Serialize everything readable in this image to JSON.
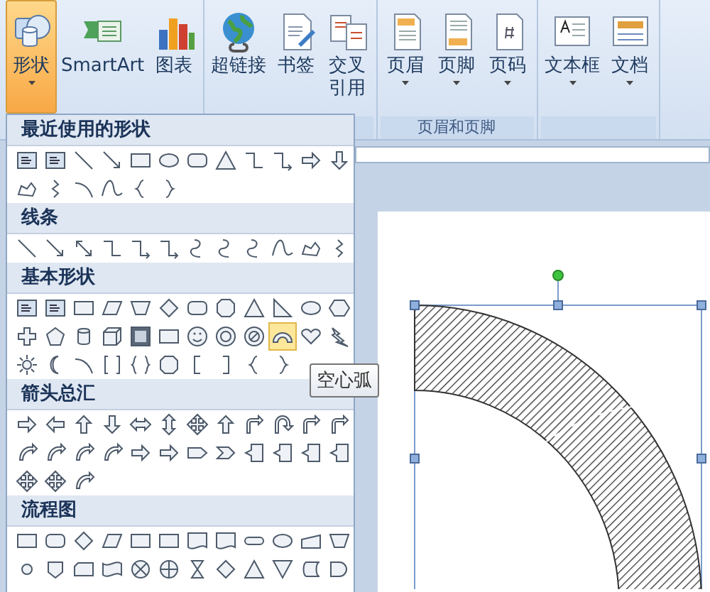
{
  "ribbon": {
    "groups": [
      {
        "buttons": [
          {
            "label": "形状",
            "has_menu": true,
            "selected": true
          },
          {
            "label": "SmartArt",
            "has_menu": false,
            "selected": false
          },
          {
            "label": "图表",
            "has_menu": false,
            "selected": false
          }
        ]
      },
      {
        "buttons": [
          {
            "label": "超链接",
            "has_menu": false,
            "selected": false
          },
          {
            "label": "书签",
            "has_menu": false,
            "selected": false
          },
          {
            "label": "交叉引用",
            "has_menu": false,
            "selected": false
          }
        ]
      },
      {
        "label": "页眉和页脚",
        "buttons": [
          {
            "label": "页眉",
            "has_menu": true,
            "selected": false
          },
          {
            "label": "页脚",
            "has_menu": true,
            "selected": false
          },
          {
            "label": "页码",
            "has_menu": true,
            "selected": false
          }
        ]
      },
      {
        "buttons": [
          {
            "label": "文本框",
            "has_menu": true,
            "selected": false
          },
          {
            "label": "文档",
            "has_menu": true,
            "selected": false
          }
        ]
      }
    ]
  },
  "shapes_menu": {
    "tooltip": "空心弧",
    "sections": [
      {
        "title": "最近使用的形状",
        "rows": [
          [
            {
              "kind": "textbox",
              "selected": false
            },
            {
              "kind": "textbox",
              "selected": false
            },
            {
              "kind": "line",
              "selected": false
            },
            {
              "kind": "arrowline",
              "selected": false
            },
            {
              "kind": "rect",
              "selected": false
            },
            {
              "kind": "oval",
              "selected": false
            },
            {
              "kind": "roundrect",
              "selected": false
            },
            {
              "kind": "triangle",
              "selected": false
            },
            {
              "kind": "elbow",
              "selected": false
            },
            {
              "kind": "elbowarrow",
              "selected": false
            },
            {
              "kind": "rarrow",
              "selected": false
            },
            {
              "kind": "darrow",
              "selected": false
            }
          ],
          [
            {
              "kind": "freeform",
              "selected": false
            },
            {
              "kind": "scribble",
              "selected": false
            },
            {
              "kind": "arc",
              "selected": false
            },
            {
              "kind": "curve",
              "selected": false
            },
            {
              "kind": "lbrace",
              "selected": false
            },
            {
              "kind": "rbrace",
              "selected": false
            }
          ]
        ]
      },
      {
        "title": "线条",
        "rows": [
          [
            {
              "kind": "line",
              "selected": false
            },
            {
              "kind": "arrowline",
              "selected": false
            },
            {
              "kind": "dblarrow",
              "selected": false
            },
            {
              "kind": "elbow",
              "selected": false
            },
            {
              "kind": "elbowarrow",
              "selected": false
            },
            {
              "kind": "elbowarrow",
              "selected": false
            },
            {
              "kind": "scurve",
              "selected": false
            },
            {
              "kind": "scurve",
              "selected": false
            },
            {
              "kind": "scurve",
              "selected": false
            },
            {
              "kind": "curve",
              "selected": false
            },
            {
              "kind": "freeform",
              "selected": false
            },
            {
              "kind": "scribble",
              "selected": false
            }
          ]
        ]
      },
      {
        "title": "基本形状",
        "rows": [
          [
            {
              "kind": "textbox",
              "selected": false
            },
            {
              "kind": "textbox",
              "selected": false
            },
            {
              "kind": "rect",
              "selected": false
            },
            {
              "kind": "parallelogram",
              "selected": false
            },
            {
              "kind": "trapezoid",
              "selected": false
            },
            {
              "kind": "diamond",
              "selected": false
            },
            {
              "kind": "roundrect",
              "selected": false
            },
            {
              "kind": "octagon",
              "selected": false
            },
            {
              "kind": "triangle",
              "selected": false
            },
            {
              "kind": "rtriangle",
              "selected": false
            },
            {
              "kind": "oval",
              "selected": false
            },
            {
              "kind": "hexagon",
              "selected": false
            }
          ],
          [
            {
              "kind": "plus",
              "selected": false
            },
            {
              "kind": "pentagon",
              "selected": false
            },
            {
              "kind": "can",
              "selected": false
            },
            {
              "kind": "cube",
              "selected": false
            },
            {
              "kind": "bevel",
              "selected": false
            },
            {
              "kind": "rect",
              "selected": false
            },
            {
              "kind": "smiley",
              "selected": false
            },
            {
              "kind": "donut",
              "selected": false
            },
            {
              "kind": "noentry",
              "selected": false
            },
            {
              "kind": "blockarc",
              "selected": true
            },
            {
              "kind": "heart",
              "selected": false
            },
            {
              "kind": "lightning",
              "selected": false
            }
          ],
          [
            {
              "kind": "sun",
              "selected": false
            },
            {
              "kind": "moon",
              "selected": false
            },
            {
              "kind": "arc",
              "selected": false
            },
            {
              "kind": "dblbracket",
              "selected": false
            },
            {
              "kind": "dblbrace",
              "selected": false
            },
            {
              "kind": "octagon",
              "selected": false
            },
            {
              "kind": "lbracket",
              "selected": false
            },
            {
              "kind": "rbracket",
              "selected": false
            },
            {
              "kind": "lbrace",
              "selected": false
            },
            {
              "kind": "rbrace",
              "selected": false
            }
          ]
        ]
      },
      {
        "title": "箭头总汇",
        "rows": [
          [
            {
              "kind": "rarrow",
              "selected": false
            },
            {
              "kind": "larrow",
              "selected": false
            },
            {
              "kind": "uarrow",
              "selected": false
            },
            {
              "kind": "darrow",
              "selected": false
            },
            {
              "kind": "lrarrow",
              "selected": false
            },
            {
              "kind": "udarrow",
              "selected": false
            },
            {
              "kind": "quadarrow",
              "selected": false
            },
            {
              "kind": "uarrow",
              "selected": false
            },
            {
              "kind": "bentarrow",
              "selected": false
            },
            {
              "kind": "uturn",
              "selected": false
            },
            {
              "kind": "bentarrow",
              "selected": false
            },
            {
              "kind": "bentarrow",
              "selected": false
            }
          ],
          [
            {
              "kind": "curvedarrow",
              "selected": false
            },
            {
              "kind": "curvedarrow",
              "selected": false
            },
            {
              "kind": "curvedarrow",
              "selected": false
            },
            {
              "kind": "curvedarrow",
              "selected": false
            },
            {
              "kind": "rarrow",
              "selected": false
            },
            {
              "kind": "rarrow",
              "selected": false
            },
            {
              "kind": "homeplate",
              "selected": false
            },
            {
              "kind": "chevron",
              "selected": false
            },
            {
              "kind": "callout",
              "selected": false
            },
            {
              "kind": "callout",
              "selected": false
            },
            {
              "kind": "callout",
              "selected": false
            },
            {
              "kind": "callout",
              "selected": false
            }
          ],
          [
            {
              "kind": "quadarrow",
              "selected": false
            },
            {
              "kind": "quadarrow",
              "selected": false
            },
            {
              "kind": "curvedarrow",
              "selected": false
            }
          ]
        ]
      },
      {
        "title": "流程图",
        "rows": [
          [
            {
              "kind": "rect",
              "selected": false
            },
            {
              "kind": "roundrect",
              "selected": false
            },
            {
              "kind": "diamond",
              "selected": false
            },
            {
              "kind": "parallelogram",
              "selected": false
            },
            {
              "kind": "rect",
              "selected": false
            },
            {
              "kind": "rect",
              "selected": false
            },
            {
              "kind": "document",
              "selected": false
            },
            {
              "kind": "document",
              "selected": false
            },
            {
              "kind": "terminator",
              "selected": false
            },
            {
              "kind": "oval",
              "selected": false
            },
            {
              "kind": "manualinput",
              "selected": false
            },
            {
              "kind": "trapezoid",
              "selected": false
            }
          ],
          [
            {
              "kind": "circle",
              "selected": false
            },
            {
              "kind": "offpage",
              "selected": false
            },
            {
              "kind": "card",
              "selected": false
            },
            {
              "kind": "tape",
              "selected": false
            },
            {
              "kind": "flowx",
              "selected": false
            },
            {
              "kind": "flowplus",
              "selected": false
            },
            {
              "kind": "hourglass",
              "selected": false
            },
            {
              "kind": "diamond",
              "selected": false
            },
            {
              "kind": "triangle",
              "selected": false
            },
            {
              "kind": "invtriangle",
              "selected": false
            },
            {
              "kind": "storeddata",
              "selected": false
            },
            {
              "kind": "delay",
              "selected": false
            }
          ]
        ]
      }
    ]
  }
}
